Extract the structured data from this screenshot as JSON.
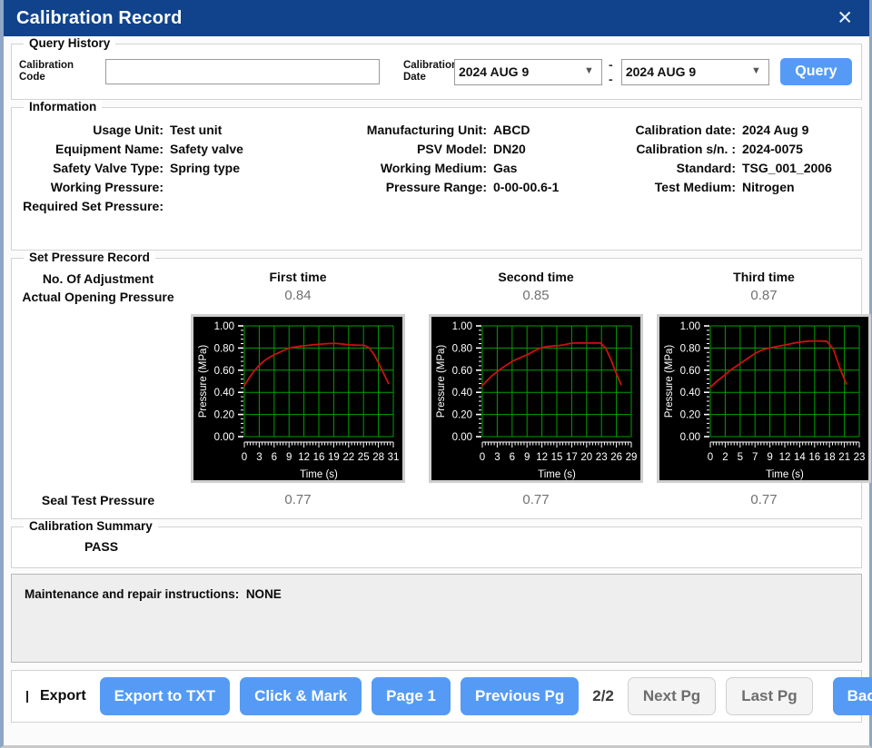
{
  "window": {
    "title": "Calibration Record",
    "close_icon": "close-icon",
    "accent_blue": "#559bf5",
    "titlebar_blue": "#11438c"
  },
  "query_history": {
    "legend": "Query History",
    "code_label": "Calibration Code",
    "code_value": "",
    "code_placeholder": "",
    "date_label_line1": "Calibration",
    "date_label_line2": "Date",
    "date_from": "2024 AUG 9",
    "date_to": "2024 AUG 9",
    "separator": "--",
    "query_button": "Query"
  },
  "information": {
    "legend": "Information",
    "fields": [
      {
        "key": "Usage Unit:",
        "value": "Test unit"
      },
      {
        "key": "Manufacturing Unit:",
        "value": "ABCD"
      },
      {
        "key": "Calibration date:",
        "value": "2024 Aug 9"
      },
      {
        "key": "Equipment Name:",
        "value": "Safety valve"
      },
      {
        "key": "PSV Model:",
        "value": "DN20"
      },
      {
        "key": "Calibration s/n. :",
        "value": "2024-0075"
      },
      {
        "key": "Safety Valve Type:",
        "value": "Spring type"
      },
      {
        "key": "Working Medium:",
        "value": "Gas"
      },
      {
        "key": "Standard:",
        "value": "TSG_001_2006"
      },
      {
        "key": "Working Pressure:",
        "value": ""
      },
      {
        "key": "Pressure Range:",
        "value": "0-00-00.6-1"
      },
      {
        "key": "Test Medium:",
        "value": "Nitrogen"
      },
      {
        "key": "Required Set Pressure:",
        "value": ""
      },
      {
        "key": "",
        "value": ""
      },
      {
        "key": "",
        "value": ""
      }
    ]
  },
  "set_pressure_record": {
    "legend": "Set Pressure Record",
    "row_label_1": "No. Of Adjustment",
    "row_label_2": "Actual Opening Pressure",
    "seal_label": "Seal Test Pressure",
    "columns": [
      {
        "title": "First time",
        "opening_pressure": "0.84",
        "seal_test_pressure": "0.77"
      },
      {
        "title": "Second time",
        "opening_pressure": "0.85",
        "seal_test_pressure": "0.77"
      },
      {
        "title": "Third time",
        "opening_pressure": "0.87",
        "seal_test_pressure": "0.77"
      }
    ]
  },
  "chart_data": [
    {
      "type": "line",
      "title": "First time",
      "xlabel": "Time (s)",
      "ylabel": "Pressure (MPa)",
      "xlim": [
        0,
        31
      ],
      "ylim": [
        0.0,
        1.0
      ],
      "xticks": [
        0,
        3,
        6,
        9,
        12,
        16,
        19,
        22,
        25,
        28,
        31
      ],
      "yticks": [
        "0.00",
        "0.20",
        "0.40",
        "0.60",
        "0.80",
        "1.00"
      ],
      "grid": true,
      "legend": "none",
      "line_color": "#cc1111",
      "grid_color": "#00a000",
      "bg_color": "#000000",
      "series": [
        {
          "name": "Pressure",
          "x": [
            0,
            1,
            2,
            3,
            4,
            5,
            6,
            7,
            8,
            9,
            10,
            11,
            12,
            13,
            14,
            15,
            16,
            17,
            18,
            19,
            20,
            21,
            22,
            23,
            24,
            25,
            26,
            27,
            28,
            29,
            30
          ],
          "y": [
            0.46,
            0.53,
            0.59,
            0.64,
            0.68,
            0.71,
            0.735,
            0.755,
            0.775,
            0.795,
            0.805,
            0.812,
            0.818,
            0.823,
            0.828,
            0.832,
            0.836,
            0.839,
            0.841,
            0.842,
            0.838,
            0.833,
            0.829,
            0.827,
            0.826,
            0.824,
            0.8,
            0.74,
            0.66,
            0.57,
            0.48
          ]
        }
      ]
    },
    {
      "type": "line",
      "title": "Second time",
      "xlabel": "Time (s)",
      "ylabel": "Pressure (MPa)",
      "xlim": [
        0,
        29
      ],
      "ylim": [
        0.0,
        1.0
      ],
      "xticks": [
        0,
        3,
        6,
        9,
        12,
        15,
        17,
        20,
        23,
        26,
        29
      ],
      "yticks": [
        "0.00",
        "0.20",
        "0.40",
        "0.60",
        "0.80",
        "1.00"
      ],
      "grid": true,
      "legend": "none",
      "line_color": "#cc1111",
      "grid_color": "#00a000",
      "bg_color": "#000000",
      "series": [
        {
          "name": "Pressure",
          "x": [
            0,
            1,
            2,
            3,
            4,
            5,
            6,
            7,
            8,
            9,
            10,
            11,
            12,
            13,
            14,
            15,
            16,
            17,
            18,
            19,
            20,
            21,
            22,
            23,
            24,
            25,
            26,
            27
          ],
          "y": [
            0.46,
            0.51,
            0.555,
            0.59,
            0.625,
            0.655,
            0.685,
            0.705,
            0.725,
            0.745,
            0.772,
            0.795,
            0.808,
            0.815,
            0.82,
            0.823,
            0.83,
            0.841,
            0.845,
            0.846,
            0.846,
            0.845,
            0.845,
            0.845,
            0.8,
            0.7,
            0.58,
            0.47
          ]
        }
      ]
    },
    {
      "type": "line",
      "title": "Third time",
      "xlabel": "Time (s)",
      "ylabel": "Pressure (MPa)",
      "xlim": [
        0,
        23
      ],
      "ylim": [
        0.0,
        1.0
      ],
      "xticks": [
        0,
        2,
        5,
        7,
        9,
        12,
        14,
        16,
        18,
        21,
        23
      ],
      "yticks": [
        "0.00",
        "0.20",
        "0.40",
        "0.60",
        "0.80",
        "1.00"
      ],
      "grid": true,
      "legend": "none",
      "line_color": "#cc1111",
      "grid_color": "#00a000",
      "bg_color": "#000000",
      "series": [
        {
          "name": "Pressure",
          "x": [
            0,
            1,
            2,
            3,
            4,
            5,
            6,
            7,
            8,
            9,
            10,
            11,
            12,
            13,
            14,
            15,
            16,
            17,
            18,
            19,
            20,
            21
          ],
          "y": [
            0.445,
            0.5,
            0.545,
            0.595,
            0.635,
            0.675,
            0.715,
            0.755,
            0.783,
            0.798,
            0.81,
            0.822,
            0.833,
            0.845,
            0.855,
            0.862,
            0.864,
            0.864,
            0.86,
            0.79,
            0.62,
            0.475
          ]
        }
      ]
    }
  ],
  "calibration_summary": {
    "legend": "Calibration Summary",
    "result": "PASS"
  },
  "notes": {
    "label": "Maintenance and repair instructions:",
    "value": "NONE"
  },
  "footer": {
    "export_checkbox_label": "Export",
    "export_txt": "Export to TXT",
    "click_mark": "Click & Mark",
    "page_1": "Page 1",
    "previous_pg": "Previous Pg",
    "page_count": "2/2",
    "next_pg": "Next Pg",
    "last_pg": "Last Pg",
    "back": "Back"
  }
}
